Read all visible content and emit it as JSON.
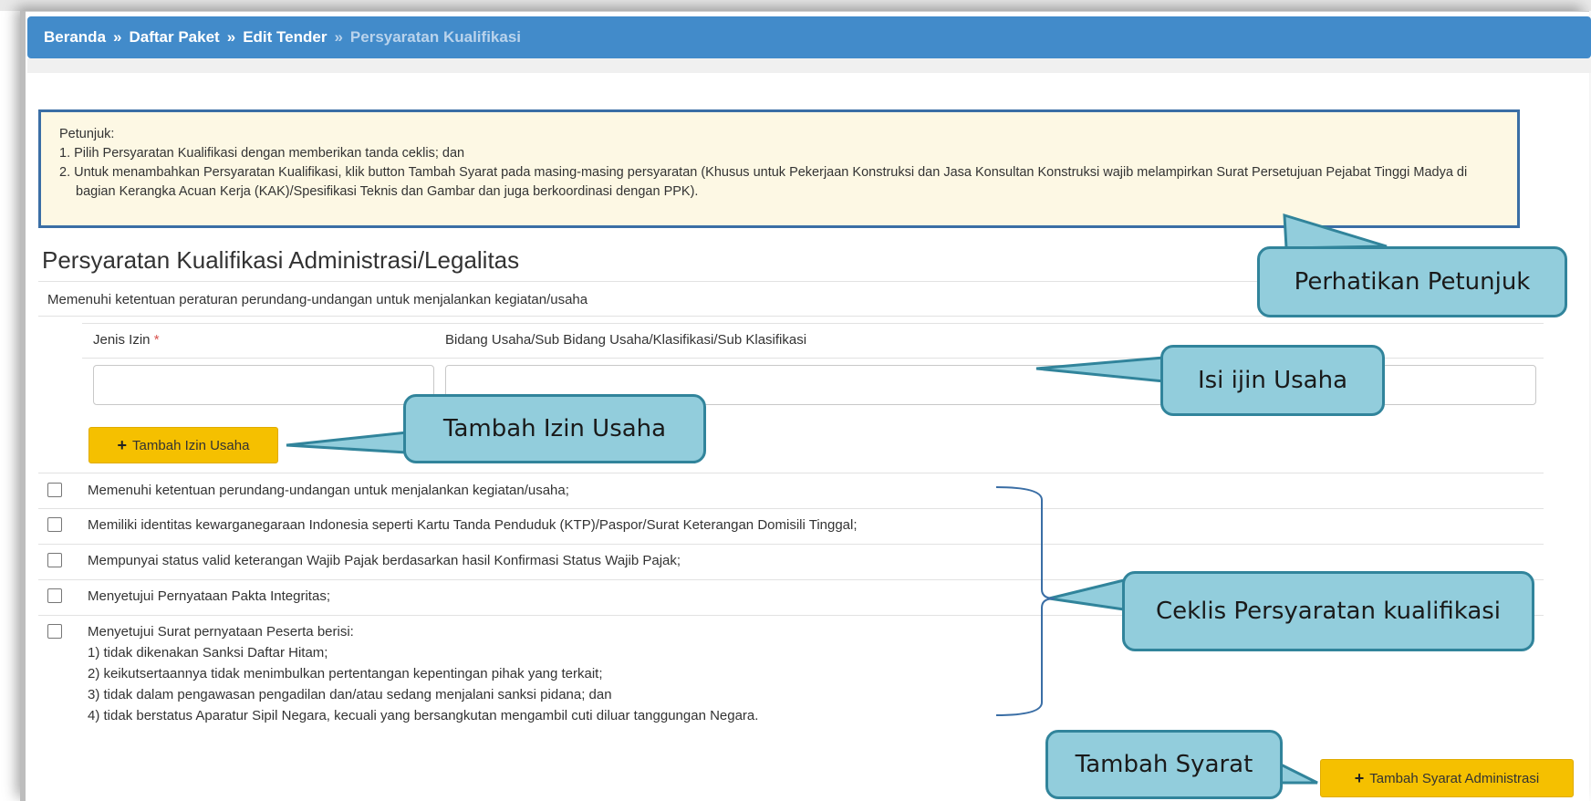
{
  "breadcrumb": {
    "home": "Beranda",
    "sep": "»",
    "package_list": "Daftar Paket",
    "edit_tender": "Edit Tender",
    "current": "Persyaratan Kualifikasi"
  },
  "guide": {
    "heading": "Petunjuk:",
    "items": [
      "1. Pilih Persyaratan Kualifikasi dengan memberikan tanda ceklis; dan",
      "2. Untuk menambahkan Persyaratan Kualifikasi, klik button Tambah Syarat pada masing-masing persyaratan (Khusus untuk Pekerjaan Konstruksi dan Jasa Konsultan Konstruksi wajib melampirkan Surat Persetujuan Pejabat Tinggi Madya di bagian Kerangka Acuan Kerja (KAK)/Spesifikasi Teknis dan Gambar dan juga berkoordinasi dengan PPK)."
    ]
  },
  "section": {
    "title": "Persyaratan Kualifikasi Administrasi/Legalitas",
    "subtitle": "Memenuhi ketentuan peraturan perundang-undangan untuk menjalankan kegiatan/usaha"
  },
  "permit_table": {
    "col_type": "Jenis Izin",
    "required_mark": "*",
    "col_field": "Bidang Usaha/Sub Bidang Usaha/Klasifikasi/Sub Klasifikasi",
    "type_value": "",
    "field_value": ""
  },
  "buttons": {
    "add_permit": "Tambah Izin Usaha",
    "add_requirement": "Tambah Syarat Administrasi"
  },
  "requirements": [
    "Memenuhi ketentuan perundang-undangan untuk menjalankan kegiatan/usaha;",
    "Memiliki identitas kewarganegaraan Indonesia seperti Kartu Tanda Penduduk (KTP)/Paspor/Surat Keterangan Domisili Tinggal;",
    "Mempunyai status valid keterangan Wajib Pajak berdasarkan hasil Konfirmasi Status Wajib Pajak;",
    "Menyetujui Pernyataan Pakta Integritas;",
    "Menyetujui Surat pernyataan Peserta berisi:"
  ],
  "statement_items": [
    "1) tidak dikenakan Sanksi Daftar Hitam;",
    "2) keikutsertaannya tidak menimbulkan pertentangan kepentingan pihak yang terkait;",
    "3) tidak dalam pengawasan pengadilan dan/atau sedang menjalani sanksi pidana; dan",
    "4) tidak berstatus Aparatur Sipil Negara, kecuali yang bersangkutan mengambil cuti diluar tanggungan Negara."
  ],
  "callouts": {
    "guide": "Perhatikan Petunjuk",
    "permit": "Isi ijin Usaha",
    "add_permit": "Tambah Izin Usaha",
    "checklist": "Ceklis Persyaratan kualifikasi",
    "add_requirement": "Tambah Syarat"
  },
  "colors": {
    "breadcrumb_bg": "#428bca",
    "alert_bg": "#fdf8e4",
    "warning_button": "#f5c000",
    "callout_fill": "#92cddc",
    "callout_border": "#31849b"
  }
}
